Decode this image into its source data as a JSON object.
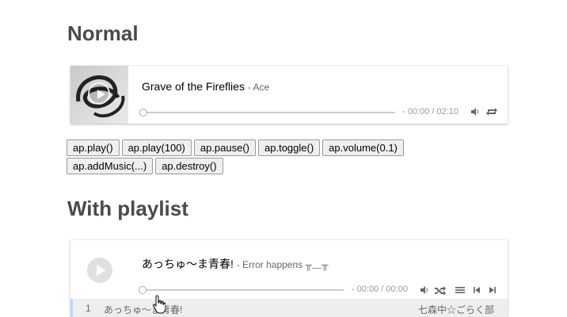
{
  "normal": {
    "heading": "Normal",
    "player": {
      "title": "Grave of the Fireflies",
      "author": "- Ace",
      "time": "- 00:00 / 02:10",
      "progress": 0
    },
    "buttons": [
      "ap.play()",
      "ap.play(100)",
      "ap.pause()",
      "ap.toggle()",
      "ap.volume(0.1)",
      "ap.addMusic(...)",
      "ap.destroy()"
    ]
  },
  "playlist": {
    "heading": "With playlist",
    "player": {
      "title": "あっちゅ～ま青春!",
      "author": "- Error happens ╥﹏╥",
      "time": "- 00:00 / 00:00",
      "progress": 0
    },
    "list": [
      {
        "index": "1",
        "title": "あっちゅ～ま青春!",
        "author": "七森中☆ごらく部"
      }
    ]
  },
  "icons": [
    "volume-icon",
    "loop-icon",
    "shuffle-icon",
    "menu-icon",
    "skip-back-icon",
    "skip-forward-icon"
  ],
  "colors": {
    "accent": "#b7daff",
    "bar": "#cdcdcd"
  }
}
